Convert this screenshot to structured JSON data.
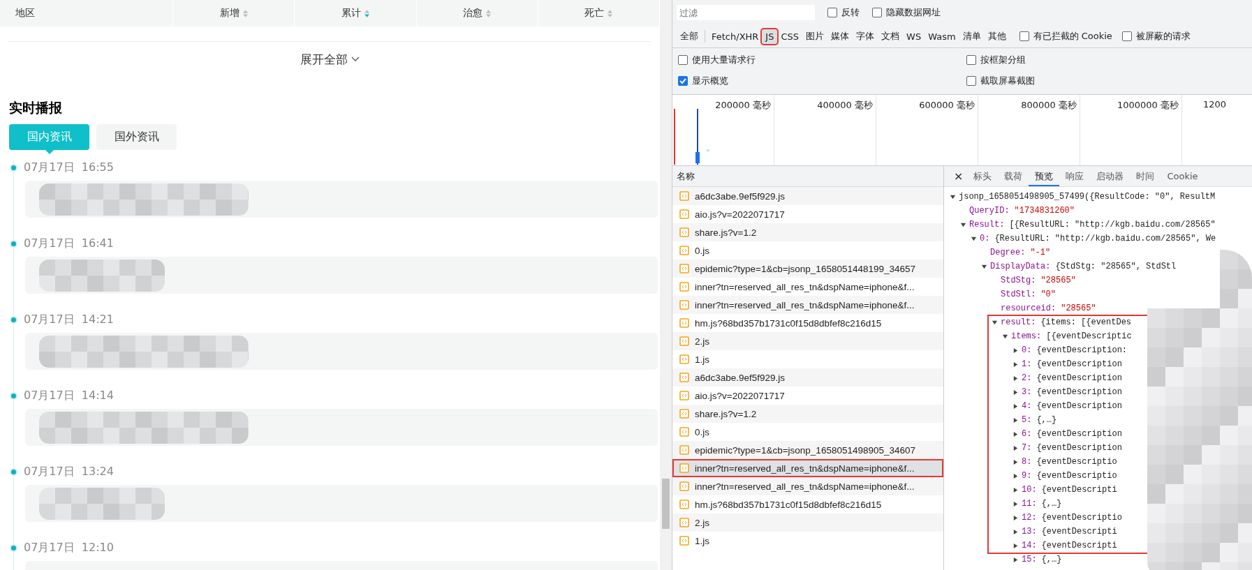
{
  "stats_table": {
    "columns": [
      {
        "label": "地区",
        "sortable": false
      },
      {
        "label": "新增",
        "sortable": true,
        "sort_active": false
      },
      {
        "label": "累计",
        "sortable": true,
        "sort_active": true
      },
      {
        "label": "治愈",
        "sortable": true,
        "sort_active": false
      },
      {
        "label": "死亡",
        "sortable": true,
        "sort_active": false
      }
    ]
  },
  "expand_all": "展开全部",
  "live_news": {
    "title": "实时播报",
    "tabs": [
      {
        "label": "国内资讯",
        "selected": true
      },
      {
        "label": "国外资讯",
        "selected": false
      }
    ],
    "items": [
      {
        "time": "07月17日 16:55"
      },
      {
        "time": "07月17日 16:41"
      },
      {
        "time": "07月17日 14:21"
      },
      {
        "time": "07月17日 14:14"
      },
      {
        "time": "07月17日 13:24"
      },
      {
        "time": "07月17日 12:10"
      }
    ]
  },
  "devtools": {
    "filter": {
      "placeholder": "过滤"
    },
    "filter_options": [
      {
        "label": "反转",
        "checked": false
      },
      {
        "label": "隐藏数据网址",
        "checked": false
      }
    ],
    "type_filters": [
      {
        "label": "全部",
        "selected": false,
        "annotated": false
      },
      {
        "label": "Fetch/XHR",
        "selected": false,
        "annotated": false
      },
      {
        "label": "JS",
        "selected": true,
        "annotated": true
      },
      {
        "label": "CSS",
        "selected": false,
        "annotated": false
      },
      {
        "label": "图片",
        "selected": false,
        "annotated": false
      },
      {
        "label": "媒体",
        "selected": false,
        "annotated": false
      },
      {
        "label": "字体",
        "selected": false,
        "annotated": false
      },
      {
        "label": "文档",
        "selected": false,
        "annotated": false
      },
      {
        "label": "WS",
        "selected": false,
        "annotated": false
      },
      {
        "label": "Wasm",
        "selected": false,
        "annotated": false
      },
      {
        "label": "清单",
        "selected": false,
        "annotated": false
      },
      {
        "label": "其他",
        "selected": false,
        "annotated": false
      }
    ],
    "type_options": [
      {
        "label": "有已拦截的 Cookie",
        "checked": false
      },
      {
        "label": "被屏蔽的请求",
        "checked": false
      }
    ],
    "settings": [
      {
        "label": "使用大量请求行",
        "checked": false
      },
      {
        "label": "按框架分组",
        "checked": false
      },
      {
        "label": "显示概览",
        "checked": true
      },
      {
        "label": "截取屏幕截图",
        "checked": false
      }
    ],
    "overview_ticks": [
      "200000 毫秒",
      "400000 毫秒",
      "600000 毫秒",
      "800000 毫秒",
      "1000000 毫秒",
      "1200"
    ],
    "requests": {
      "column": "名称",
      "rows": [
        {
          "name": "a6dc3abe.9ef5f929.js",
          "selected": false,
          "annotated": false
        },
        {
          "name": "aio.js?v=2022071717",
          "selected": false,
          "annotated": false
        },
        {
          "name": "share.js?v=1.2",
          "selected": false,
          "annotated": false
        },
        {
          "name": "0.js",
          "selected": false,
          "annotated": false
        },
        {
          "name": "epidemic?type=1&cb=jsonp_1658051448199_34657",
          "selected": false,
          "annotated": false
        },
        {
          "name": "inner?tn=reserved_all_res_tn&dspName=iphone&f...",
          "selected": false,
          "annotated": false
        },
        {
          "name": "inner?tn=reserved_all_res_tn&dspName=iphone&f...",
          "selected": false,
          "annotated": false
        },
        {
          "name": "hm.js?68bd357b1731c0f15d8dbfef8c216d15",
          "selected": false,
          "annotated": false
        },
        {
          "name": "2.js",
          "selected": false,
          "annotated": false
        },
        {
          "name": "1.js",
          "selected": false,
          "annotated": false
        },
        {
          "name": "a6dc3abe.9ef5f929.js",
          "selected": false,
          "annotated": false
        },
        {
          "name": "aio.js?v=2022071717",
          "selected": false,
          "annotated": false
        },
        {
          "name": "share.js?v=1.2",
          "selected": false,
          "annotated": false
        },
        {
          "name": "0.js",
          "selected": false,
          "annotated": false
        },
        {
          "name": "epidemic?type=1&cb=jsonp_1658051498905_34607",
          "selected": false,
          "annotated": false
        },
        {
          "name": "inner?tn=reserved_all_res_tn&dspName=iphone&f...",
          "selected": true,
          "annotated": true
        },
        {
          "name": "inner?tn=reserved_all_res_tn&dspName=iphone&f...",
          "selected": false,
          "annotated": false
        },
        {
          "name": "hm.js?68bd357b1731c0f15d8dbfef8c216d15",
          "selected": false,
          "annotated": false
        },
        {
          "name": "2.js",
          "selected": false,
          "annotated": false
        },
        {
          "name": "1.js",
          "selected": false,
          "annotated": false
        }
      ]
    },
    "detail_close": "×",
    "detail_tabs": [
      {
        "label": "标头",
        "selected": false
      },
      {
        "label": "载荷",
        "selected": false
      },
      {
        "label": "预览",
        "selected": true
      },
      {
        "label": "响应",
        "selected": false
      },
      {
        "label": "启动器",
        "selected": false
      },
      {
        "label": "时间",
        "selected": false
      },
      {
        "label": "Cookie",
        "selected": false
      }
    ],
    "preview": [
      {
        "value": "jsonp_1658051498905_57499({ResultCode: \"0\", ResultM",
        "kind": "object",
        "expanded": true,
        "annotated": false,
        "children": [
          {
            "key": "QueryID:",
            "value": "\"1734831260\"",
            "kind": "string",
            "annotated": false
          },
          {
            "key": "Result:",
            "value": "[{ResultURL: \"http://kgb.baidu.com/28565\"",
            "kind": "object",
            "expanded": true,
            "annotated": false,
            "children": [
              {
                "key": "0:",
                "value": "{ResultURL: \"http://kgb.baidu.com/28565\", We",
                "kind": "object",
                "expanded": true,
                "annotated": false,
                "children": [
                  {
                    "key": "Degree:",
                    "value": "\"-1\"",
                    "kind": "string",
                    "annotated": false
                  },
                  {
                    "key": "DisplayData:",
                    "value": "{StdStg: \"28565\", StdStl",
                    "kind": "object",
                    "expanded": true,
                    "annotated": false,
                    "children": [
                      {
                        "key": "StdStg:",
                        "value": "\"28565\"",
                        "kind": "string",
                        "annotated": false
                      },
                      {
                        "key": "StdStl:",
                        "value": "\"0\"",
                        "kind": "string",
                        "annotated": false
                      },
                      {
                        "key": "resourceid:",
                        "value": "\"28565\"",
                        "kind": "string",
                        "annotated": false
                      },
                      {
                        "key": "result:",
                        "value": "{items: [{eventDes",
                        "kind": "object",
                        "expanded": true,
                        "annotated": true,
                        "children": [
                          {
                            "key": "items:",
                            "value": "[{eventDescriptic",
                            "kind": "object",
                            "expanded": true,
                            "annotated": true,
                            "children": [
                              {
                                "key": "0:",
                                "value": "{eventDescription:",
                                "kind": "object",
                                "expanded": false,
                                "annotated": true
                              },
                              {
                                "key": "1:",
                                "value": "{eventDescription",
                                "kind": "object",
                                "expanded": false,
                                "annotated": true
                              },
                              {
                                "key": "2:",
                                "value": "{eventDescription",
                                "kind": "object",
                                "expanded": false,
                                "annotated": true
                              },
                              {
                                "key": "3:",
                                "value": "{eventDescription",
                                "kind": "object",
                                "expanded": false,
                                "annotated": true
                              },
                              {
                                "key": "4:",
                                "value": "{eventDescription",
                                "kind": "object",
                                "expanded": false,
                                "annotated": true
                              },
                              {
                                "key": "5:",
                                "value": "{,…}",
                                "kind": "object",
                                "expanded": false,
                                "annotated": true
                              },
                              {
                                "key": "6:",
                                "value": "{eventDescription",
                                "kind": "object",
                                "expanded": false,
                                "annotated": true
                              },
                              {
                                "key": "7:",
                                "value": "{eventDescription",
                                "kind": "object",
                                "expanded": false,
                                "annotated": true
                              },
                              {
                                "key": "8:",
                                "value": "{eventDescriptio",
                                "kind": "object",
                                "expanded": false,
                                "annotated": true
                              },
                              {
                                "key": "9:",
                                "value": "{eventDescriptio",
                                "kind": "object",
                                "expanded": false,
                                "annotated": true
                              },
                              {
                                "key": "10:",
                                "value": "{eventDescripti",
                                "kind": "object",
                                "expanded": false,
                                "annotated": true
                              },
                              {
                                "key": "11:",
                                "value": "{,…}",
                                "kind": "object",
                                "expanded": false,
                                "annotated": true
                              },
                              {
                                "key": "12:",
                                "value": "{eventDescriptio",
                                "kind": "object",
                                "expanded": false,
                                "annotated": true
                              },
                              {
                                "key": "13:",
                                "value": "{eventDescripti",
                                "kind": "object",
                                "expanded": false,
                                "annotated": true
                              },
                              {
                                "key": "14:",
                                "value": "{eventDescripti",
                                "kind": "object",
                                "expanded": false,
                                "annotated": true
                              },
                              {
                                "key": "15:",
                                "value": "{,…}",
                                "kind": "object",
                                "expanded": false,
                                "annotated": false
                              }
                            ]
                          }
                        ]
                      }
                    ]
                  }
                ]
              }
            ]
          }
        ]
      }
    ]
  }
}
